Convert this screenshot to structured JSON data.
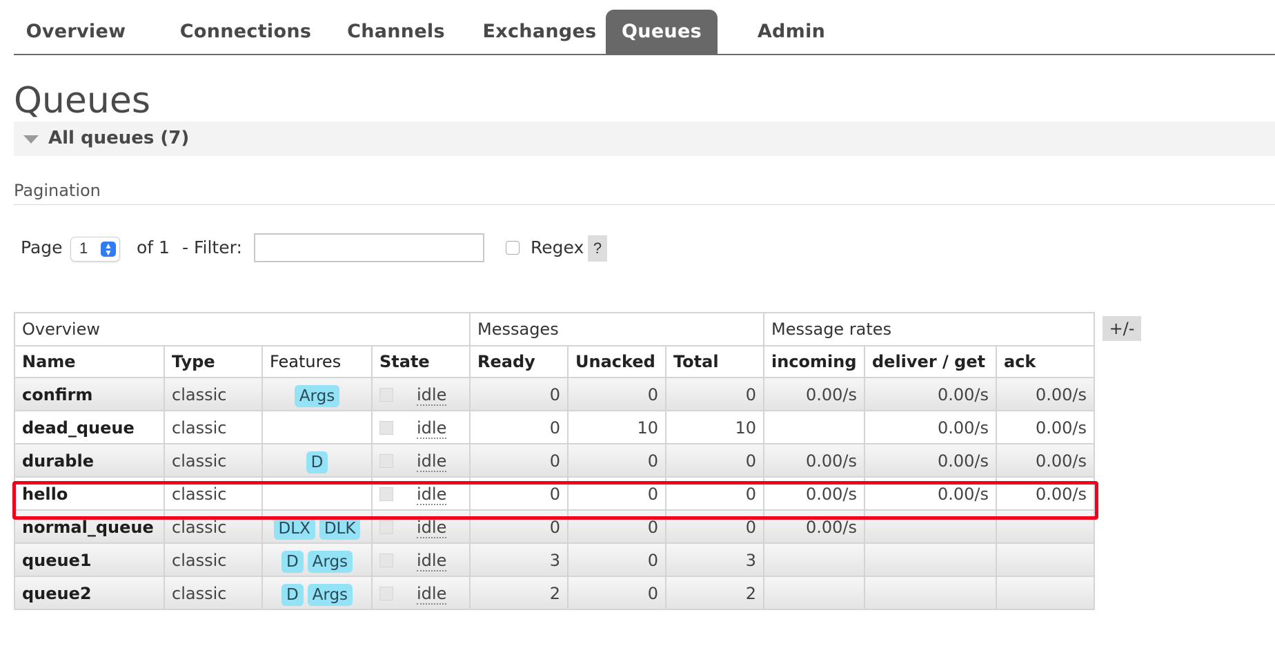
{
  "nav": {
    "tabs": [
      "Overview",
      "Connections",
      "Channels",
      "Exchanges",
      "Queues",
      "Admin"
    ],
    "active": "Queues"
  },
  "page": {
    "title": "Queues",
    "section_label": "All queues (7)",
    "pagination_label": "Pagination"
  },
  "pagination": {
    "page_label": "Page",
    "page_value": "1",
    "of_label": "of 1",
    "filter_label": "- Filter:",
    "filter_value": "",
    "regex_label": "Regex",
    "regex_checked": false,
    "help_label": "?"
  },
  "table": {
    "groups": [
      "Overview",
      "Messages",
      "Message rates"
    ],
    "columns": [
      "Name",
      "Type",
      "Features",
      "State",
      "Ready",
      "Unacked",
      "Total",
      "incoming",
      "deliver / get",
      "ack"
    ],
    "toggle_label": "+/-",
    "rows": [
      {
        "name": "confirm",
        "type": "classic",
        "features": [
          "Args"
        ],
        "state": "idle",
        "ready": "0",
        "unacked": "0",
        "total": "0",
        "incoming": "0.00/s",
        "deliver": "0.00/s",
        "ack": "0.00/s"
      },
      {
        "name": "dead_queue",
        "type": "classic",
        "features": [],
        "state": "idle",
        "ready": "0",
        "unacked": "10",
        "total": "10",
        "incoming": "",
        "deliver": "0.00/s",
        "ack": "0.00/s"
      },
      {
        "name": "durable",
        "type": "classic",
        "features": [
          "D"
        ],
        "state": "idle",
        "ready": "0",
        "unacked": "0",
        "total": "0",
        "incoming": "0.00/s",
        "deliver": "0.00/s",
        "ack": "0.00/s"
      },
      {
        "name": "hello",
        "type": "classic",
        "features": [],
        "state": "idle",
        "ready": "0",
        "unacked": "0",
        "total": "0",
        "incoming": "0.00/s",
        "deliver": "0.00/s",
        "ack": "0.00/s"
      },
      {
        "name": "normal_queue",
        "type": "classic",
        "features": [
          "DLX",
          "DLK"
        ],
        "state": "idle",
        "ready": "0",
        "unacked": "0",
        "total": "0",
        "incoming": "0.00/s",
        "deliver": "",
        "ack": ""
      },
      {
        "name": "queue1",
        "type": "classic",
        "features": [
          "D",
          "Args"
        ],
        "state": "idle",
        "ready": "3",
        "unacked": "0",
        "total": "3",
        "incoming": "",
        "deliver": "",
        "ack": ""
      },
      {
        "name": "queue2",
        "type": "classic",
        "features": [
          "D",
          "Args"
        ],
        "state": "idle",
        "ready": "2",
        "unacked": "0",
        "total": "2",
        "incoming": "",
        "deliver": "",
        "ack": ""
      }
    ]
  },
  "annotation": {
    "highlighted_row": "hello",
    "color": "#f2001c"
  }
}
